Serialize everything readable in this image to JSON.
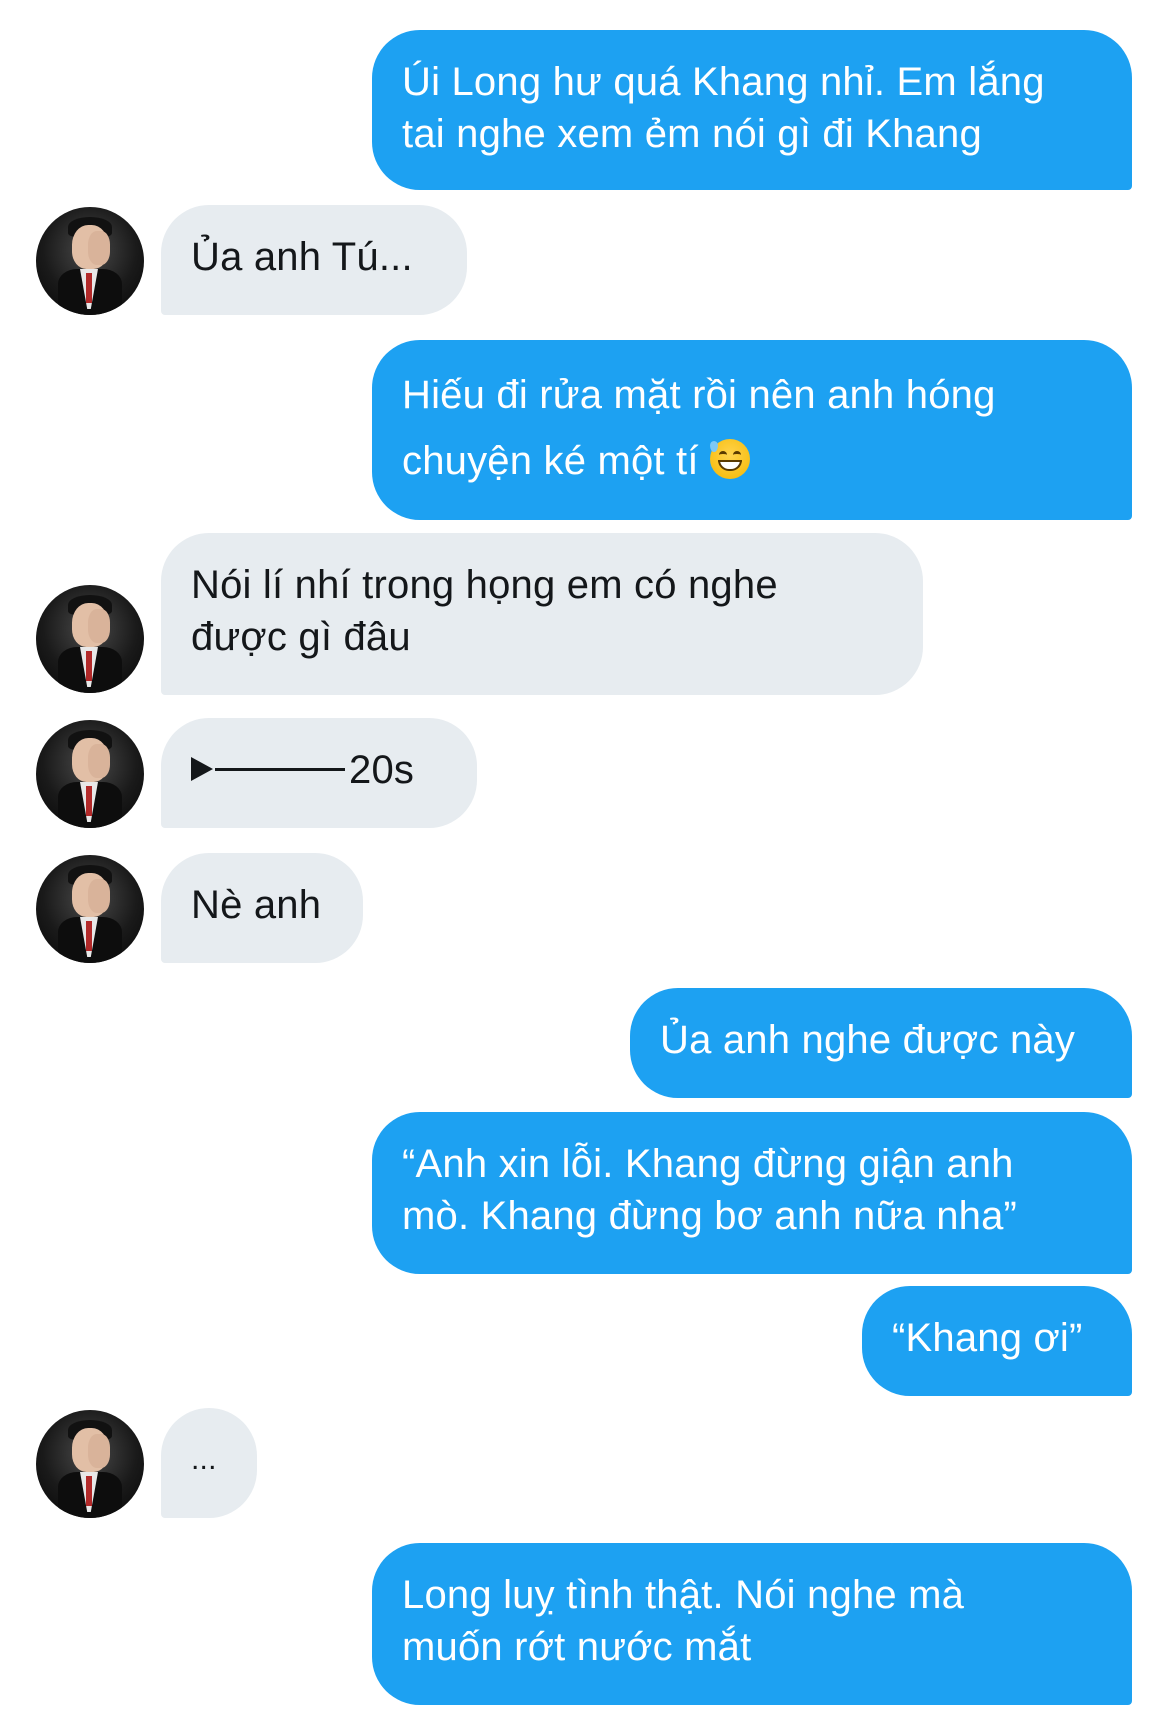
{
  "conversation": {
    "messages": [
      {
        "side": "out",
        "lines": [
          "Úi Long hư quá Khang nhỉ. Em lắng",
          "tai nghe xem ẻm nói gì đi Khang"
        ]
      },
      {
        "side": "in",
        "lines": [
          "Ủa anh Tú..."
        ]
      },
      {
        "side": "out",
        "lines": [
          "Hiếu đi rửa mặt rồi nên anh hóng",
          "chuyện ké một tí"
        ],
        "emoji": "grinning-sweat-emoji"
      },
      {
        "side": "in",
        "lines": [
          "Nói lí nhí trong họng em có nghe",
          "được gì đâu"
        ]
      },
      {
        "side": "in",
        "type": "voice",
        "duration": "20s"
      },
      {
        "side": "in",
        "lines": [
          "Nè anh"
        ]
      },
      {
        "side": "out",
        "lines": [
          "Ủa anh nghe được này"
        ]
      },
      {
        "side": "out",
        "lines": [
          "“Anh xin lỗi. Khang đừng giận anh",
          "mò. Khang đừng bơ anh nữa nha”"
        ]
      },
      {
        "side": "out",
        "lines": [
          "“Khang ơi”"
        ]
      },
      {
        "side": "in",
        "lines": [
          "..."
        ]
      },
      {
        "side": "out",
        "lines": [
          "Long luỵ tình thật. Nói nghe mà",
          "muốn rớt nước mắt"
        ]
      }
    ]
  },
  "colors": {
    "outgoing_bubble": "#1da1f2",
    "incoming_bubble": "#e7ecf0",
    "incoming_text": "#14171a",
    "outgoing_text": "#ffffff"
  },
  "icons": {
    "avatar": "profile-photo-avatar",
    "voice_play": "play-icon",
    "emoji": "grinning-sweat-emoji"
  }
}
